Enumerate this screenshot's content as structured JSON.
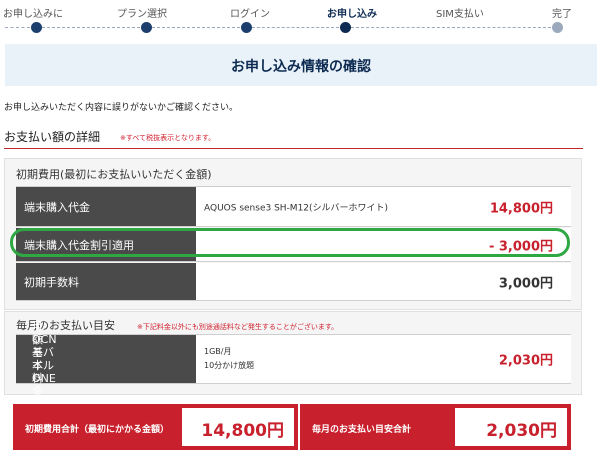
{
  "steps": [
    {
      "label": "お申し込みに",
      "state": "done"
    },
    {
      "label": "プラン選択",
      "state": "done"
    },
    {
      "label": "ログイン",
      "state": "done"
    },
    {
      "label": "お申し込み",
      "state": "current"
    },
    {
      "label": "SIM支払い",
      "state": "todo"
    },
    {
      "label": "完了",
      "state": "todo"
    }
  ],
  "page": {
    "title": "お申し込み情報の確認",
    "intro": "お申し込みいただく内容に誤りがないかご確認ください。"
  },
  "payment": {
    "title": "お支払い額の詳細",
    "note": "※すべて税抜表示となります。"
  },
  "initial": {
    "heading": "初期費用(最初にお支払いいただく金額)",
    "rows": [
      {
        "label": "端末購入代金",
        "desc": "AQUOS sense3 SH-M12(シルバーホワイト)",
        "price": "14,800円"
      },
      {
        "label": "端末購入代金割引適用",
        "desc": "",
        "price": "- 3,000円"
      },
      {
        "label": "初期手数料",
        "desc": "",
        "price": "3,000円"
      }
    ]
  },
  "monthly": {
    "heading": "毎月のお支払い目安",
    "note": "※下記料金以外にも別途通話料など発生することがございます。",
    "row": {
      "label_line1": "OCN モバイル ONE",
      "label_line2": "月額基本料金",
      "desc_line1": "1GB/月",
      "desc_line2": "10分かけ放題",
      "price": "2,030円"
    }
  },
  "totals": {
    "initial_label": "初期費用合計（最初にかかる金額）",
    "initial_value": "14,800円",
    "monthly_label": "毎月のお支払い目安合計",
    "monthly_value": "2,030円"
  },
  "colors": {
    "accent_red": "#c8202c",
    "navy": "#0d2b52",
    "highlight_green": "#2fa844"
  }
}
